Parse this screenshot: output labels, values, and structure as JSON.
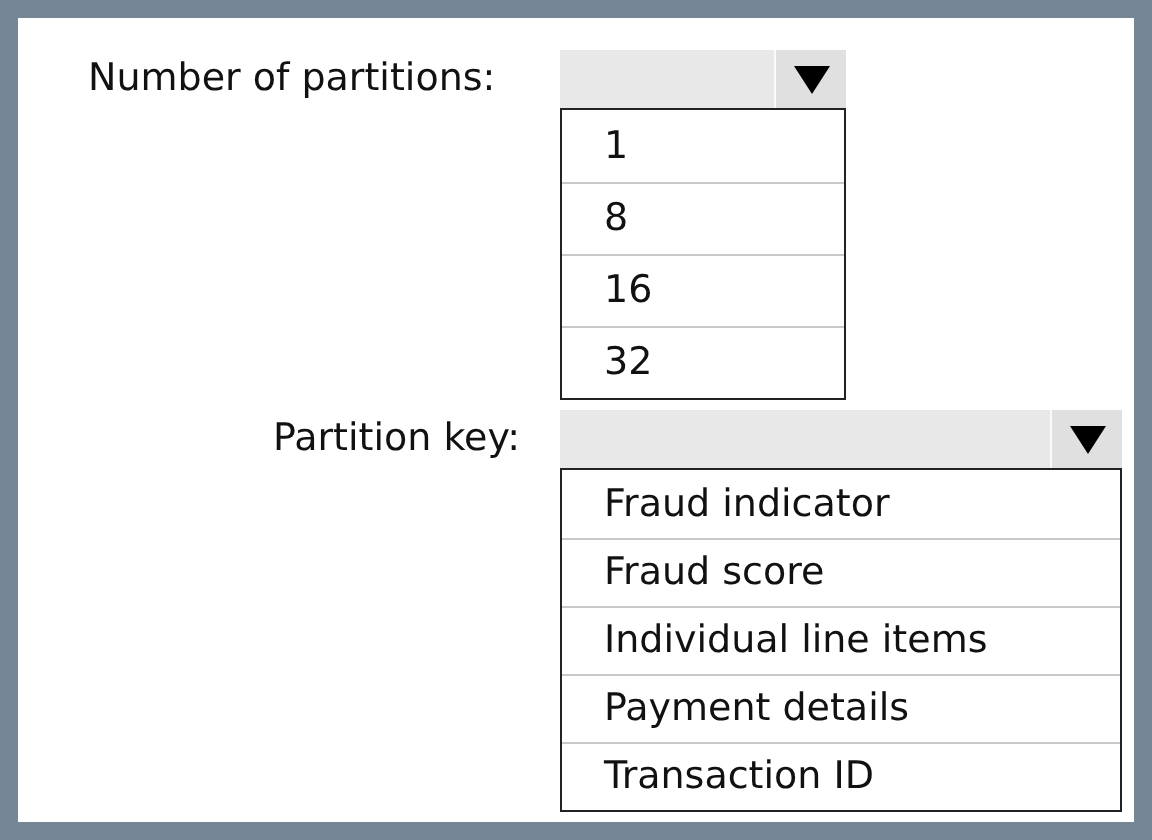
{
  "dropdowns": [
    {
      "label": "Number of partitions:",
      "expanded": true,
      "options": [
        {
          "label": "1",
          "selected": false
        },
        {
          "label": "8",
          "selected": false
        },
        {
          "label": "16",
          "selected": false
        },
        {
          "label": "32",
          "selected": false
        }
      ]
    },
    {
      "label": "Partition key:",
      "expanded": true,
      "options": [
        {
          "label": "Fraud indicator",
          "selected": false
        },
        {
          "label": "Fraud score",
          "selected": false
        },
        {
          "label": "Individual line items",
          "selected": false
        },
        {
          "label": "Payment details",
          "selected": false
        },
        {
          "label": "Transaction ID",
          "selected": false
        }
      ]
    }
  ]
}
